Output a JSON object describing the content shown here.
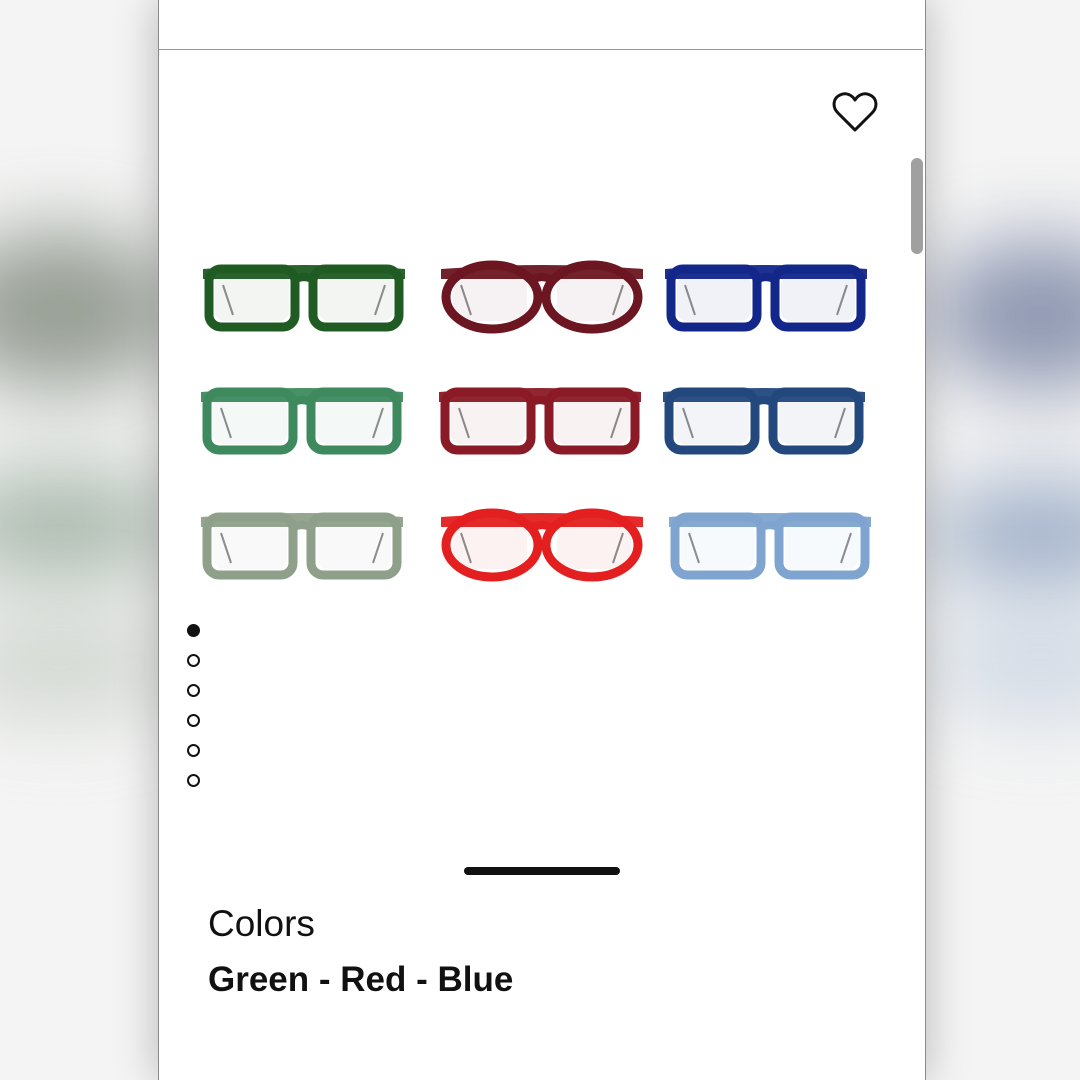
{
  "product": {
    "favorite_icon": "heart-outline-icon",
    "gallery": {
      "slides_total": 6,
      "active_slide": 1,
      "frames": [
        {
          "color": "#1f5b23"
        },
        {
          "color": "#6b1620"
        },
        {
          "color": "#13268a"
        },
        {
          "color": "#3e8a5e"
        },
        {
          "color": "#8a1a25"
        },
        {
          "color": "#23487e"
        },
        {
          "color": "#8fa08a"
        },
        {
          "color": "#e41f1f"
        },
        {
          "color": "#7fa4cf"
        }
      ]
    }
  },
  "details": {
    "colors_label": "Colors",
    "colors_value": "Green - Red - Blue"
  }
}
